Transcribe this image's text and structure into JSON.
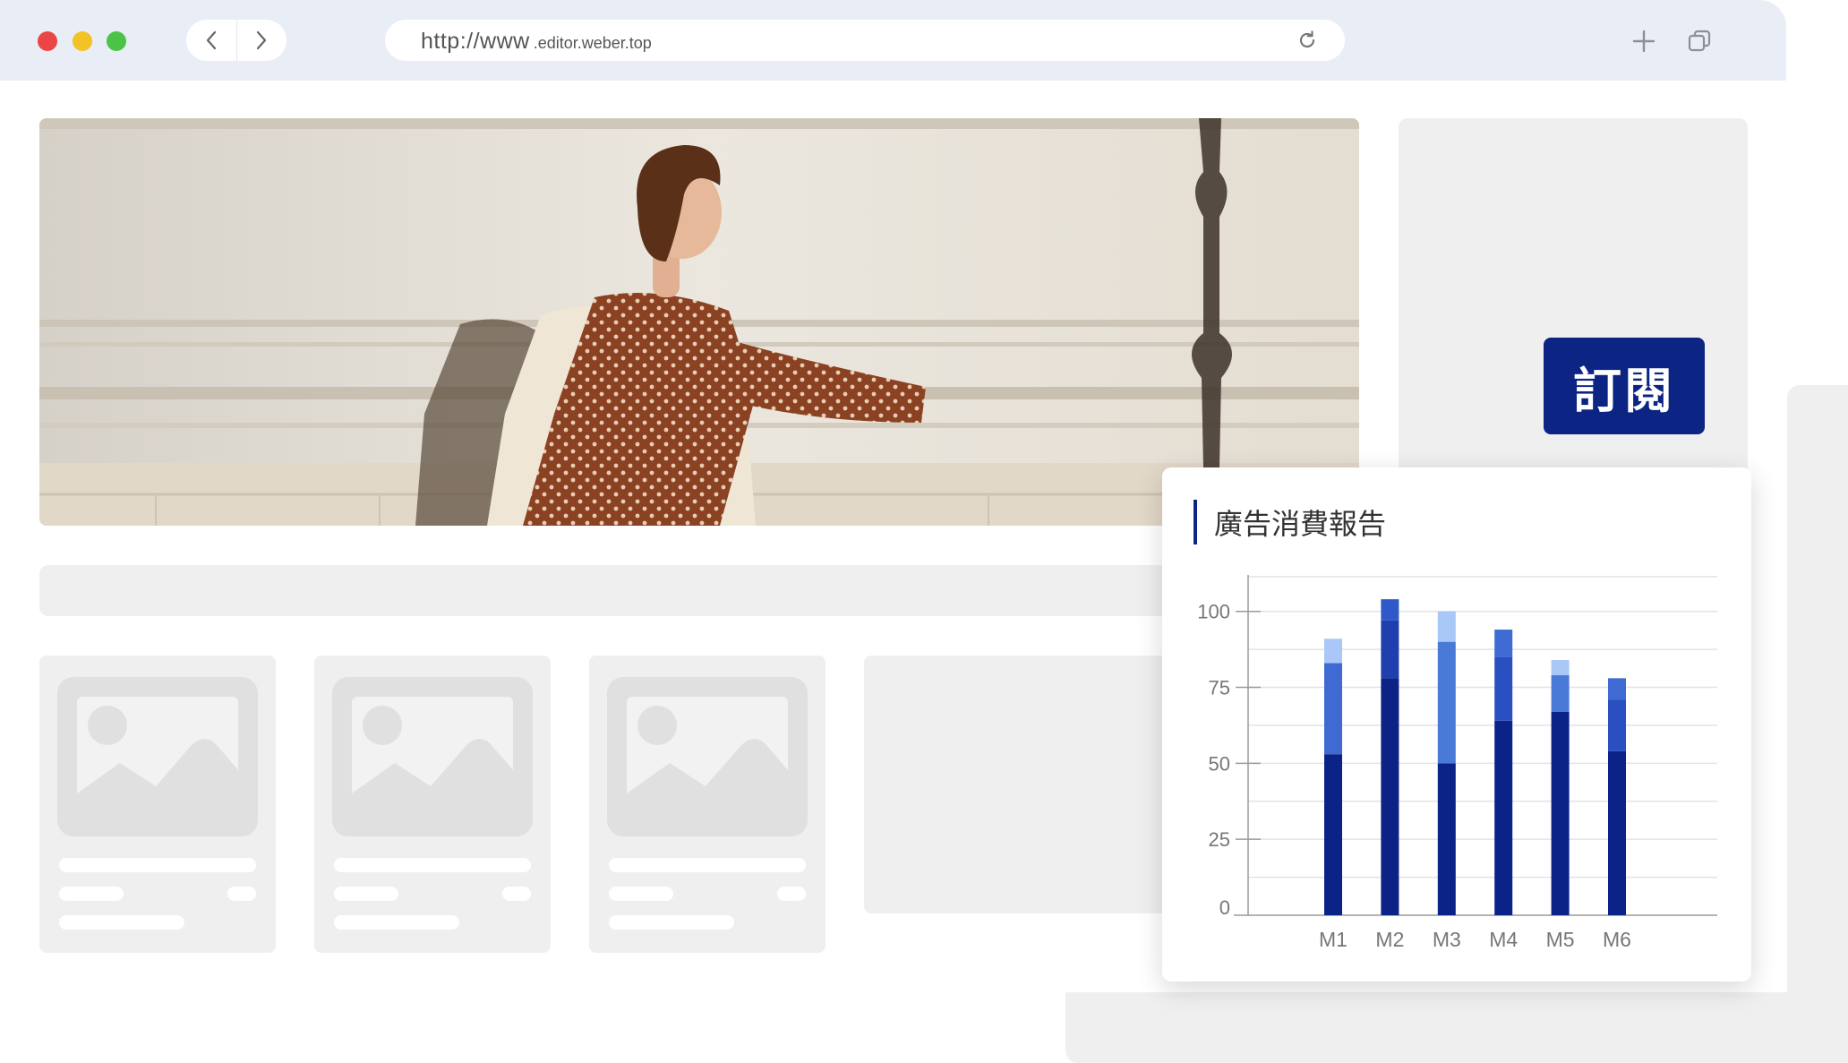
{
  "browser": {
    "url_protocol": "http://www",
    "url_domain": ".editor.weber.top"
  },
  "sidebar": {
    "subscribe_label": "訂閱"
  },
  "report": {
    "title": "廣告消費報告"
  },
  "colors": {
    "accent": "#0c2484",
    "series": [
      "#0b2286",
      "#2a4fc0",
      "#4a7ad8",
      "#a9c8f7"
    ]
  },
  "chart_data": {
    "type": "bar",
    "stacked": true,
    "title": "廣告消費報告",
    "categories": [
      "M1",
      "M2",
      "M3",
      "M4",
      "M5",
      "M6"
    ],
    "yticks": [
      0,
      25,
      50,
      75,
      100
    ],
    "ylim": [
      0,
      112
    ],
    "grid": true,
    "stacks": [
      [
        {
          "value": 53,
          "color": "#0b2286"
        },
        {
          "value": 30,
          "color": "#3e6ad2"
        },
        {
          "value": 8,
          "color": "#a9c8f7"
        }
      ],
      [
        {
          "value": 78,
          "color": "#0b2286"
        },
        {
          "value": 19,
          "color": "#1f3fae"
        },
        {
          "value": 7,
          "color": "#2f58c8"
        }
      ],
      [
        {
          "value": 50,
          "color": "#0b2286"
        },
        {
          "value": 40,
          "color": "#4a7ad8"
        },
        {
          "value": 10,
          "color": "#a9c8f7"
        }
      ],
      [
        {
          "value": 64,
          "color": "#0b2286"
        },
        {
          "value": 21,
          "color": "#2a4fc0"
        },
        {
          "value": 9,
          "color": "#3e6ad2"
        }
      ],
      [
        {
          "value": 67,
          "color": "#0b2286"
        },
        {
          "value": 12,
          "color": "#4a7ad8"
        },
        {
          "value": 5,
          "color": "#a9c8f7"
        }
      ],
      [
        {
          "value": 54,
          "color": "#0b2286"
        },
        {
          "value": 17,
          "color": "#2a4fc0"
        },
        {
          "value": 7,
          "color": "#3e6ad2"
        }
      ]
    ]
  }
}
